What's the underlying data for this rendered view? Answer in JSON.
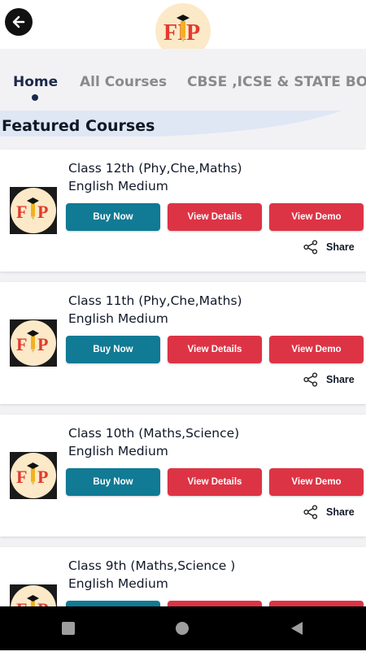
{
  "header": {
    "back_icon": "arrow-left-icon",
    "logo_text": "FIP"
  },
  "tabs": [
    {
      "label": "Home",
      "active": true
    },
    {
      "label": "All Courses",
      "active": false
    },
    {
      "label": "CBSE ,ICSE & STATE BOA",
      "active": false
    }
  ],
  "section_title": "Featured Courses",
  "courses": [
    {
      "title": "Class 12th (Phy,Che,Maths)",
      "medium": "English Medium"
    },
    {
      "title": "Class 11th (Phy,Che,Maths)",
      "medium": "English Medium"
    },
    {
      "title": "Class 10th (Maths,Science)",
      "medium": "English Medium"
    },
    {
      "title": "Class 9th (Maths,Science )",
      "medium": "English Medium"
    }
  ],
  "buttons": {
    "buy_now": "Buy Now",
    "view_details": "View Details",
    "view_demo": "View Demo",
    "share": "Share"
  },
  "colors": {
    "buy_button": "#117a94",
    "red_button": "#dc3445",
    "logo_red": "#e23b2e",
    "logo_bg": "#fbe9c8",
    "active_tab": "#1b2a4a"
  },
  "system_nav": {
    "icons": [
      "recents-square-icon",
      "home-circle-icon",
      "back-triangle-icon"
    ]
  }
}
